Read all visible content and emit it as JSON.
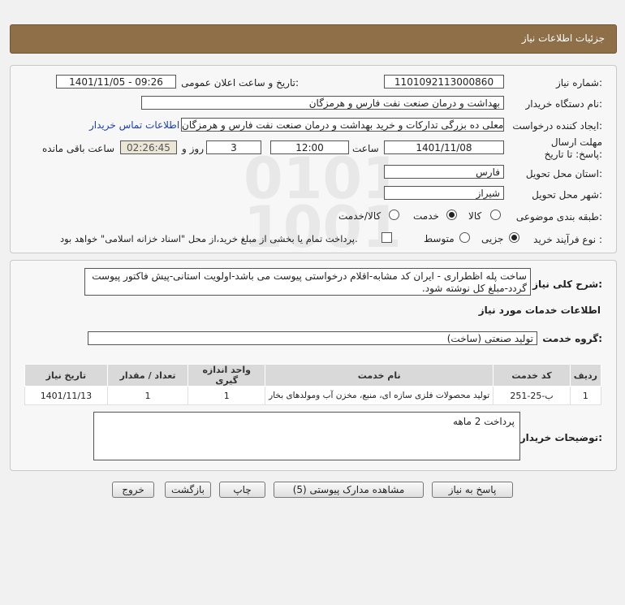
{
  "header": {
    "title": "جزئیات اطلاعات نیاز"
  },
  "form": {
    "need_number": {
      "label": "شماره نیاز:",
      "value": "1101092113000860"
    },
    "announce": {
      "label": "تاریخ و ساعت اعلان عمومی:",
      "value": "1401/11/05 - 09:26"
    },
    "buyer_org": {
      "label": "نام دستگاه خریدار:",
      "value": "بهداشت و درمان صنعت نفت فارس و هرمزگان"
    },
    "requester": {
      "label": "ایجاد کننده درخواست:",
      "value": "غلامعلی ده بزرگی تدارکات و خرید بهداشت و درمان صنعت نفت فارس و هرمزگان",
      "contact_link": "اطلاعات تماس خریدار"
    },
    "deadline": {
      "label": "مهلت ارسال پاسخ: تا تاریخ:",
      "date": "1401/11/08",
      "time_label": "ساعت",
      "time": "12:00",
      "days": "3",
      "days_label": "روز و",
      "remaining": "02:26:45",
      "remaining_label": "ساعت باقی مانده"
    },
    "province": {
      "label": "استان محل تحویل:",
      "value": "فارس"
    },
    "city": {
      "label": "شهر محل تحویل:",
      "value": "شیراز"
    },
    "category": {
      "label": "طبقه بندی موضوعی:",
      "options": [
        "کالا",
        "خدمت",
        "کالا/خدمت"
      ],
      "selected": "خدمت"
    },
    "process": {
      "label": "نوع فرآیند خرید :",
      "options": [
        "جزیی",
        "متوسط"
      ],
      "selected": "جزیی",
      "checkbox_text": "پرداخت تمام یا بخشی از مبلغ خرید،از محل \"اسناد خزانه اسلامی\" خواهد بود."
    }
  },
  "description": {
    "label": "شرح کلی نیاز:",
    "text": "ساخت پله اظطراری - ایران کد مشابه-اقلام درخواستی پیوست می باشد-اولویت استانی-پیش فاکتور پیوست گردد-مبلغ کل نوشته شود."
  },
  "services": {
    "section_title": "اطلاعات خدمات مورد نیاز",
    "group_label": "گروه خدمت:",
    "group_value": "تولید صنعتی (ساخت)",
    "columns": [
      "ردیف",
      "کد خدمت",
      "نام خدمت",
      "واحد اندازه گیری",
      "تعداد / مقدار",
      "تاریخ نیاز"
    ],
    "rows": [
      [
        "1",
        "ب-25-251",
        "تولید محصولات فلزی سازه ای، منبع، مخزن آب ومولدهای بخار",
        "1",
        "1",
        "1401/11/13"
      ]
    ]
  },
  "buyer_notes": {
    "label": "توضیحات خریدار:",
    "text": "پرداخت 2 ماهه"
  },
  "buttons": {
    "reply": "پاسخ به نیاز",
    "attachments": "مشاهده مدارک پیوستی (5)",
    "print": "چاپ",
    "back": "بازگشت",
    "exit": "خروج"
  },
  "colors": {
    "header_bg": "#8f6f47",
    "link": "#1a3fb3"
  }
}
